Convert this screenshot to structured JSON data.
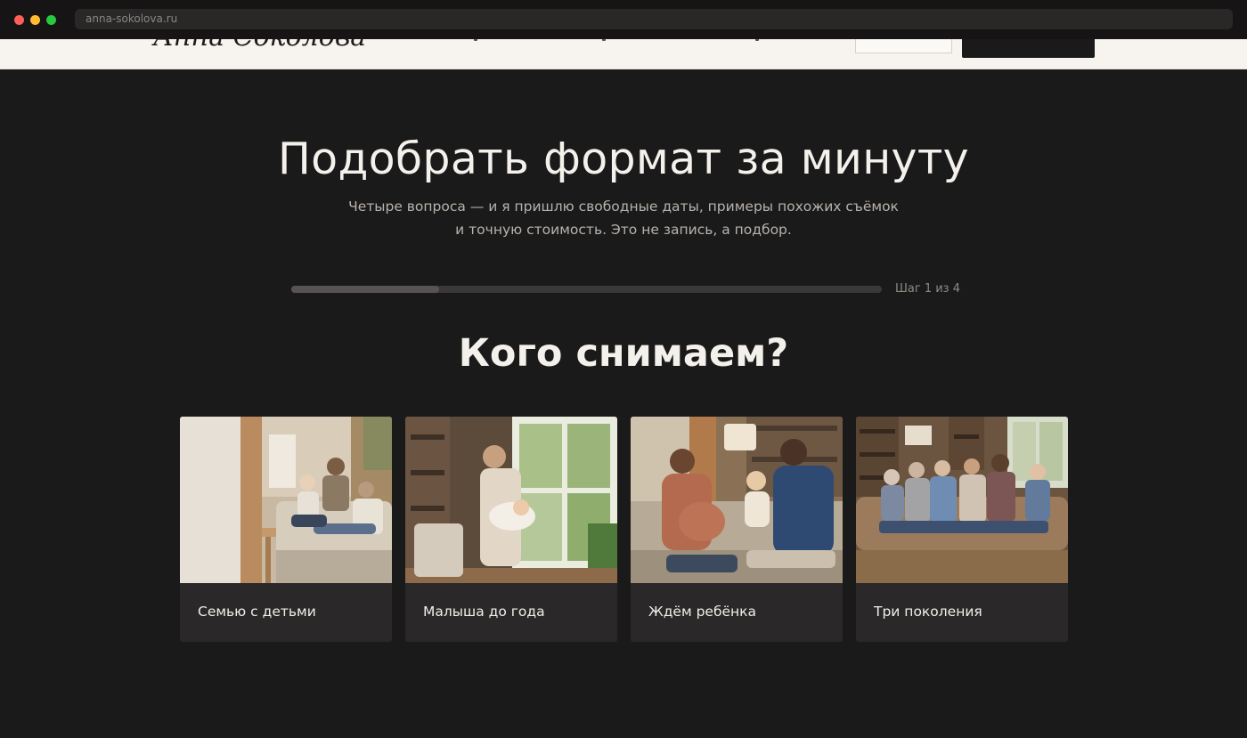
{
  "browser": {
    "url": "anna-sokolova.ru"
  },
  "header": {
    "logo_text": "Анна Соколова"
  },
  "quiz": {
    "title": "Подобрать формат за минуту",
    "subtitle": "Четыре вопроса — и я пришлю свободные даты, примеры похожих съёмок и точную стоимость. Это не запись, а подбор.",
    "progress_fraction": 0.25,
    "step_label": "Шаг 1 из 4",
    "question": "Кого снимаем?",
    "options": [
      {
        "label": "Семью с детьми",
        "photo": "family-with-children-photo"
      },
      {
        "label": "Малыша до года",
        "photo": "baby-under-one-photo"
      },
      {
        "label": "Ждём ребёнка",
        "photo": "expecting-baby-photo"
      },
      {
        "label": "Три поколения",
        "photo": "three-generations-photo"
      }
    ]
  },
  "colors": {
    "background": "#1b1a1a",
    "header_bg": "#f7f3ee",
    "card_bg": "#2a2828",
    "text_primary": "#f4f1ec",
    "text_secondary": "#b7b2ac"
  }
}
